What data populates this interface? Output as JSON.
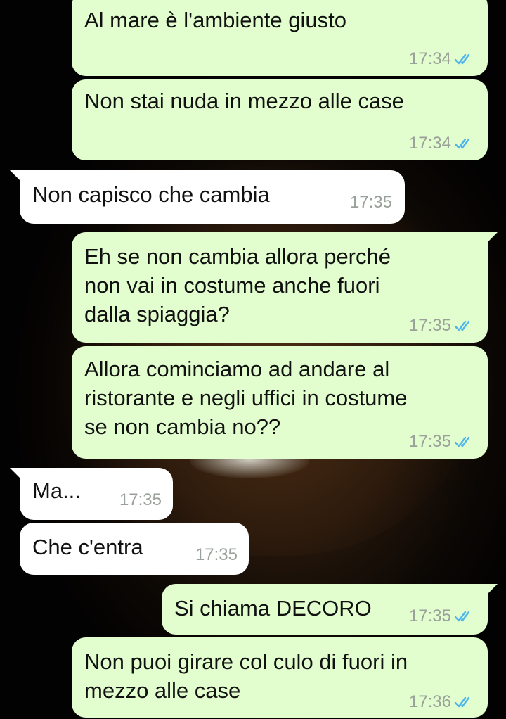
{
  "colors": {
    "outgoing_bubble": "#e2fdce",
    "incoming_bubble": "#ffffff",
    "read_ticks": "#4fb6ec",
    "timestamp": "#9aa09a"
  },
  "messages": [
    {
      "direction": "out",
      "text": "Al mare è l'ambiente giusto",
      "time": "17:34",
      "ticks": "double-check-read"
    },
    {
      "direction": "out",
      "text": "Non stai nuda in mezzo alle case",
      "time": "17:34",
      "ticks": "double-check-read"
    },
    {
      "direction": "in",
      "text": "Non capisco che cambia",
      "time": "17:35"
    },
    {
      "direction": "out",
      "text": "Eh se non cambia allora perché\nnon vai in costume anche fuori\ndalla spiaggia?",
      "time": "17:35",
      "ticks": "double-check-read"
    },
    {
      "direction": "out",
      "text": "Allora cominciamo ad andare al\nristorante e negli uffici in costume\nse non cambia no??",
      "time": "17:35",
      "ticks": "double-check-read"
    },
    {
      "direction": "in",
      "text": "Ma...",
      "time": "17:35"
    },
    {
      "direction": "in",
      "text": "Che c'entra",
      "time": "17:35"
    },
    {
      "direction": "out",
      "text": "Si chiama DECORO",
      "time": "17:35",
      "ticks": "double-check-read"
    },
    {
      "direction": "out",
      "text": "Non puoi girare col culo di fuori in\nmezzo alle case",
      "time": "17:36",
      "ticks": "double-check-read"
    }
  ]
}
